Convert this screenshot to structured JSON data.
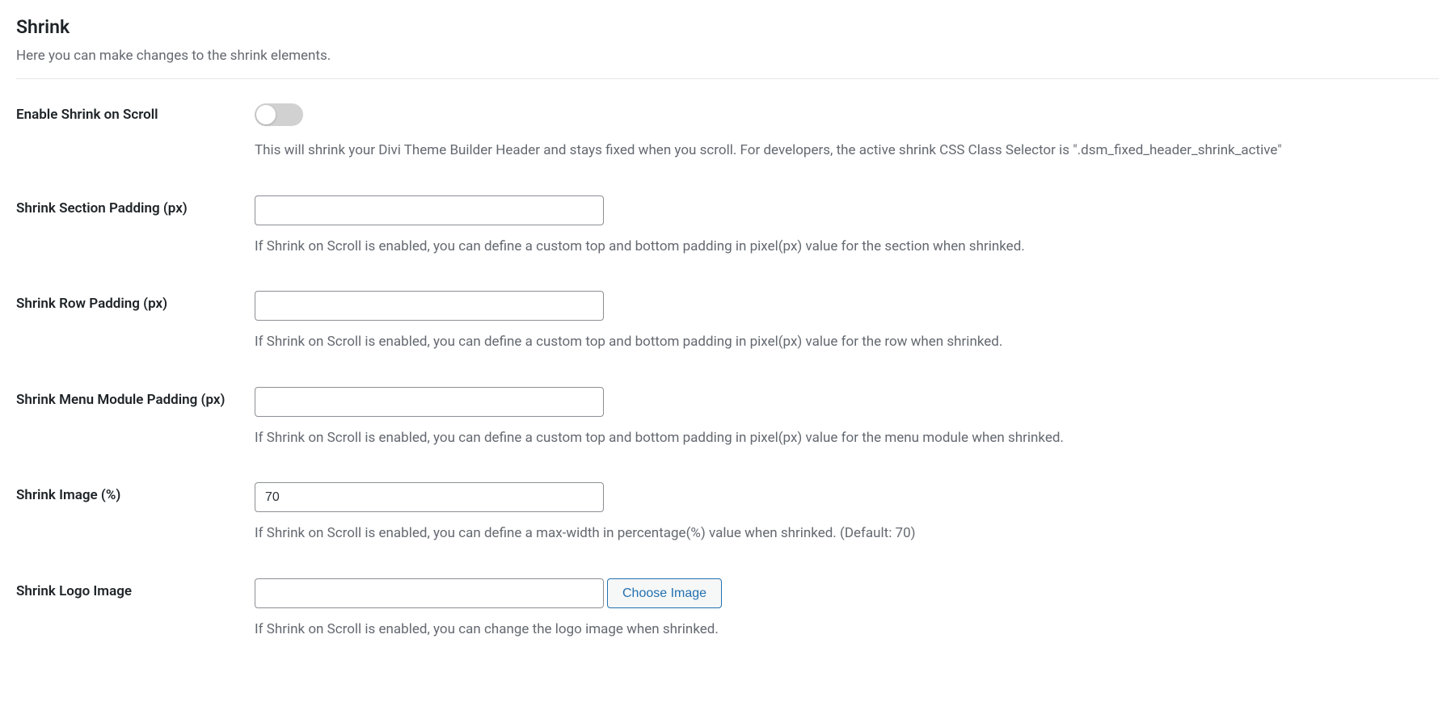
{
  "header": {
    "title": "Shrink",
    "subtitle": "Here you can make changes to the shrink elements."
  },
  "fields": {
    "enable_shrink": {
      "label": "Enable Shrink on Scroll",
      "toggled": false,
      "description": "This will shrink your Divi Theme Builder Header and stays fixed when you scroll. For developers, the active shrink CSS Class Selector is \".dsm_fixed_header_shrink_active\""
    },
    "section_padding": {
      "label": "Shrink Section Padding (px)",
      "value": "",
      "description": "If Shrink on Scroll is enabled, you can define a custom top and bottom padding in pixel(px) value for the section when shrinked."
    },
    "row_padding": {
      "label": "Shrink Row Padding (px)",
      "value": "",
      "description": "If Shrink on Scroll is enabled, you can define a custom top and bottom padding in pixel(px) value for the row when shrinked."
    },
    "menu_padding": {
      "label": "Shrink Menu Module Padding (px)",
      "value": "",
      "description": "If Shrink on Scroll is enabled, you can define a custom top and bottom padding in pixel(px) value for the menu module when shrinked."
    },
    "shrink_image": {
      "label": "Shrink Image (%)",
      "value": "70",
      "description": "If Shrink on Scroll is enabled, you can define a max-width in percentage(%) value when shrinked. (Default: 70)"
    },
    "logo_image": {
      "label": "Shrink Logo Image",
      "value": "",
      "button_label": "Choose Image",
      "description": "If Shrink on Scroll is enabled, you can change the logo image when shrinked."
    }
  }
}
